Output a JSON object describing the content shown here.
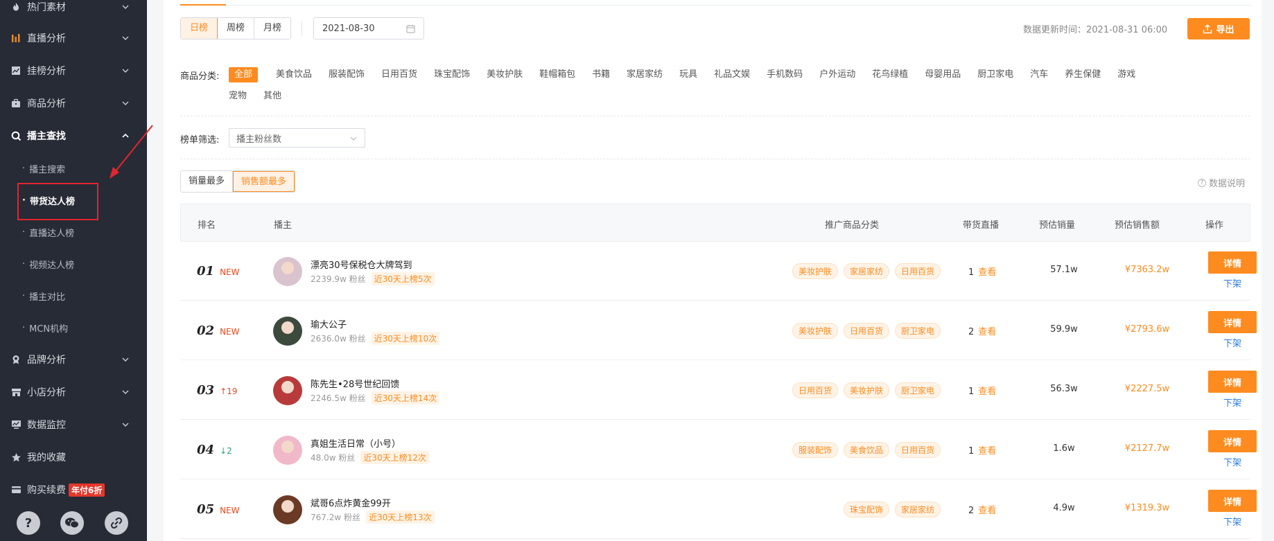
{
  "sidebar": {
    "items": [
      {
        "label": "热门素材",
        "icon": "fire-icon"
      },
      {
        "label": "直播分析",
        "icon": "bar-chart-icon"
      },
      {
        "label": "挂榜分析",
        "icon": "line-chart-icon"
      },
      {
        "label": "商品分析",
        "icon": "bag-icon"
      },
      {
        "label": "播主查找",
        "icon": "search-icon"
      },
      {
        "label": "品牌分析",
        "icon": "brand-icon"
      },
      {
        "label": "小店分析",
        "icon": "store-icon"
      },
      {
        "label": "数据监控",
        "icon": "monitor-icon"
      },
      {
        "label": "我的收藏",
        "icon": "star-icon"
      },
      {
        "label": "购买续费",
        "icon": "card-icon",
        "badge": "年付6折"
      }
    ],
    "subitems": [
      "播主搜索",
      "带货达人榜",
      "直播达人榜",
      "视频达人榜",
      "播主对比",
      "MCN机构"
    ],
    "bottom_icons": [
      "help-icon",
      "wechat-icon",
      "link-icon"
    ],
    "help_glyph": "?"
  },
  "toolbar": {
    "period_tabs": [
      "日榜",
      "周榜",
      "月榜"
    ],
    "date": "2021-08-30",
    "update_label": "数据更新时间：",
    "update_time": "2021-08-31 06:00",
    "export_label": "导出"
  },
  "category": {
    "label": "商品分类:",
    "row1": [
      "全部",
      "美食饮品",
      "服装配饰",
      "日用百货",
      "珠宝配饰",
      "美妆护肤",
      "鞋帽箱包",
      "书籍",
      "家居家纺",
      "玩具",
      "礼品文娱",
      "手机数码",
      "户外运动",
      "花鸟绿植",
      "母婴用品",
      "厨卫家电",
      "汽车",
      "养生保健",
      "游戏"
    ],
    "row2": [
      "宠物",
      "其他"
    ]
  },
  "filter": {
    "label": "榜单筛选:",
    "placeholder": "播主粉丝数"
  },
  "sort": {
    "tabs": [
      "销量最多",
      "销售额最多"
    ],
    "note": "数据说明"
  },
  "table": {
    "headers": [
      "排名",
      "播主",
      "推广商品分类",
      "带货直播",
      "预估销量",
      "预估销售额",
      "操作"
    ],
    "view_label": "查看",
    "detail_label": "详情",
    "offline_label": "下架",
    "rows": [
      {
        "rank": "01",
        "tag": "NEW",
        "tag_type": "new",
        "name": "漂亮30号保税仓大牌驾到",
        "fans": "2239.9w 粉丝",
        "onlist": "近30天上榜5次",
        "tags": [
          "美妆护肤",
          "家居家纺",
          "日用百货"
        ],
        "live": "1",
        "sales": "57.1w",
        "gmv": "¥7363.2w",
        "avatar_color": "#d9c3cf"
      },
      {
        "rank": "02",
        "tag": "NEW",
        "tag_type": "new",
        "name": "瑜大公子",
        "fans": "2636.0w 粉丝",
        "onlist": "近30天上榜10次",
        "tags": [
          "美妆护肤",
          "日用百货",
          "厨卫家电"
        ],
        "live": "2",
        "sales": "59.9w",
        "gmv": "¥2793.6w",
        "avatar_color": "#3b4a3d"
      },
      {
        "rank": "03",
        "tag": "↑19",
        "tag_type": "up",
        "name": "陈先生•28号世纪回馈",
        "fans": "2246.5w 粉丝",
        "onlist": "近30天上榜14次",
        "tags": [
          "日用百货",
          "美妆护肤",
          "厨卫家电"
        ],
        "live": "1",
        "sales": "56.3w",
        "gmv": "¥2227.5w",
        "avatar_color": "#b83a3a"
      },
      {
        "rank": "04",
        "tag": "↓2",
        "tag_type": "down",
        "name": "真姐生活日常（小号）",
        "fans": "48.0w 粉丝",
        "onlist": "近30天上榜12次",
        "tags": [
          "服装配饰",
          "美食饮品",
          "日用百货"
        ],
        "live": "1",
        "sales": "1.6w",
        "gmv": "¥2127.7w",
        "avatar_color": "#f0b8c8"
      },
      {
        "rank": "05",
        "tag": "NEW",
        "tag_type": "new",
        "name": "斌哥6点炸黄金99开",
        "fans": "767.2w 粉丝",
        "onlist": "近30天上榜13次",
        "tags": [
          "珠宝配饰",
          "家居家纺"
        ],
        "live": "2",
        "sales": "4.9w",
        "gmv": "¥1319.3w",
        "avatar_color": "#6a3a24"
      }
    ]
  },
  "colors": {
    "accent": "#fd8b1f",
    "sidebar_bg": "#272b36",
    "highlight_red": "#e3252f",
    "link_blue": "#2e7bdc"
  }
}
